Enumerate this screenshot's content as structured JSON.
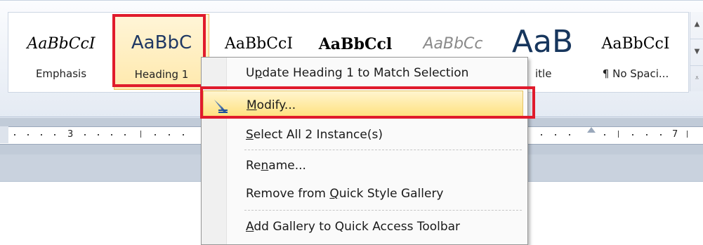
{
  "gallery": {
    "styles": [
      {
        "preview": "AaBbCcI",
        "label": "Emphasis"
      },
      {
        "preview": "AaBbC",
        "label": "Heading 1"
      },
      {
        "preview": "AaBbCcI",
        "label": ""
      },
      {
        "preview": "AaBbCcl",
        "label": ""
      },
      {
        "preview": "AaBbCc",
        "label": ""
      },
      {
        "preview": "AaB",
        "label": "itle"
      },
      {
        "preview": "AaBbCcI",
        "label": "¶ No Spaci..."
      }
    ],
    "scroll_up_icon": "chevron-up-icon",
    "scroll_down_icon": "chevron-down-icon",
    "more_icon": "dropdown-more-icon"
  },
  "ruler": {
    "labels": [
      "3",
      "7"
    ]
  },
  "context_menu": {
    "items": [
      {
        "label": "Update Heading 1 to Match Selection",
        "access_key": "p"
      },
      {
        "label": "Modify...",
        "access_key": "M",
        "highlighted": true,
        "icon": "modify-style-icon"
      },
      {
        "label": "Select All 2 Instance(s)",
        "access_key": "S"
      },
      {
        "label": "Rename...",
        "access_key": "n"
      },
      {
        "label": "Remove from Quick Style Gallery",
        "access_key": "Q"
      },
      {
        "label": "Add Gallery to Quick Access Toolbar",
        "access_key": "A"
      }
    ]
  },
  "colors": {
    "highlight_border": "#e01b2c",
    "menu_highlight": "#ffe07a",
    "ribbon": "#e4eaf3"
  }
}
